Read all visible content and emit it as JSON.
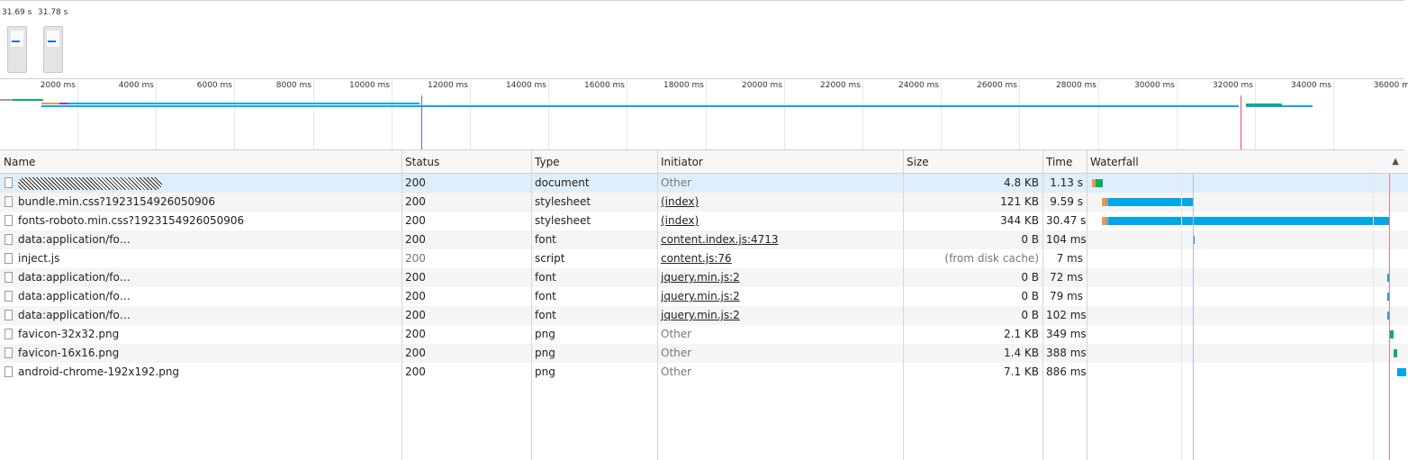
{
  "filmstrip": {
    "frames": [
      {
        "time": "31.69 s"
      },
      {
        "time": "31.78 s"
      }
    ]
  },
  "overview": {
    "ticks": [
      "2000 ms",
      "4000 ms",
      "6000 ms",
      "8000 ms",
      "10000 ms",
      "12000 ms",
      "14000 ms",
      "16000 ms",
      "18000 ms",
      "20000 ms",
      "22000 ms",
      "24000 ms",
      "26000 ms",
      "28000 ms",
      "30000 ms",
      "32000 ms",
      "34000 ms",
      "36000 m"
    ]
  },
  "columns": {
    "name": "Name",
    "status": "Status",
    "type": "Type",
    "initiator": "Initiator",
    "size": "Size",
    "time": "Time",
    "waterfall": "Waterfall",
    "sort_indicator": "▲"
  },
  "rows": [
    {
      "name": "",
      "status": "200",
      "type": "document",
      "initiator": "Other",
      "size": "4.8 KB",
      "time": "1.13 s"
    },
    {
      "name": "bundle.min.css?1923154926050906",
      "status": "200",
      "type": "stylesheet",
      "initiator": "(index)",
      "size": "121 KB",
      "time": "9.59 s"
    },
    {
      "name": "fonts-roboto.min.css?1923154926050906",
      "status": "200",
      "type": "stylesheet",
      "initiator": "(index)",
      "size": "344 KB",
      "time": "30.47 s"
    },
    {
      "name": "data:application/fo…",
      "status": "200",
      "type": "font",
      "initiator": "content.index.js:4713",
      "size": "0 B",
      "time": "104 ms"
    },
    {
      "name": "inject.js",
      "status": "200",
      "type": "script",
      "initiator": "content.js:76",
      "size": "(from disk cache)",
      "time": "7 ms"
    },
    {
      "name": "data:application/fo…",
      "status": "200",
      "type": "font",
      "initiator": "jquery.min.js:2",
      "size": "0 B",
      "time": "72 ms"
    },
    {
      "name": "data:application/fo…",
      "status": "200",
      "type": "font",
      "initiator": "jquery.min.js:2",
      "size": "0 B",
      "time": "79 ms"
    },
    {
      "name": "data:application/fo…",
      "status": "200",
      "type": "font",
      "initiator": "jquery.min.js:2",
      "size": "0 B",
      "time": "102 ms"
    },
    {
      "name": "favicon-32x32.png",
      "status": "200",
      "type": "png",
      "initiator": "Other",
      "size": "2.1 KB",
      "time": "349 ms"
    },
    {
      "name": "favicon-16x16.png",
      "status": "200",
      "type": "png",
      "initiator": "Other",
      "size": "1.4 KB",
      "time": "388 ms"
    },
    {
      "name": "android-chrome-192x192.png",
      "status": "200",
      "type": "png",
      "initiator": "Other",
      "size": "7.1 KB",
      "time": "886 ms"
    }
  ],
  "colors": {
    "receiving": "#00a6e8",
    "waiting": "#00b35a",
    "stalled": "#9e9e9e",
    "dom_content_loaded": "#6b63e8",
    "load": "#e84a5f"
  }
}
